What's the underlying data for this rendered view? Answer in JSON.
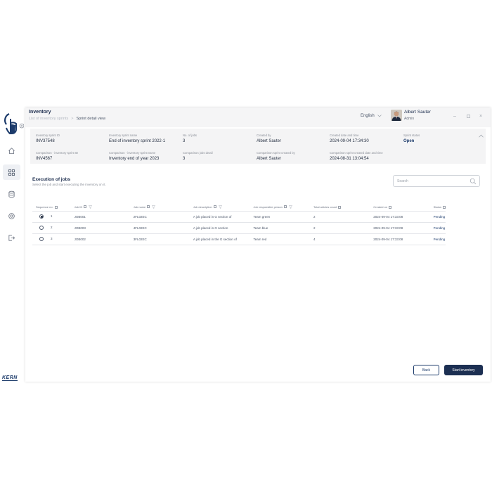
{
  "brand": "KERN",
  "header": {
    "title": "Inventory",
    "breadcrumb": [
      "List of inventory sprints",
      "Sprint detail view"
    ],
    "language": "English",
    "user_name": "Albert Sauter",
    "user_role": "Admin"
  },
  "info": {
    "fields": [
      {
        "label": "Inventory sprint ID",
        "value": "INV37548"
      },
      {
        "label": "Inventory sprint name",
        "value": "End of inventory sprint 2022-1"
      },
      {
        "label": "No. of jobs",
        "value": "3"
      },
      {
        "label": "Created by",
        "value": "Albert Sauter"
      },
      {
        "label": "Created date and time",
        "value": "2024-09-04 17:34:30"
      },
      {
        "label": "Sprint status",
        "value": "Open"
      },
      {
        "label": "Comparison - inventory sprint ID",
        "value": "INV4567"
      },
      {
        "label": "Comparison - inventory sprint name",
        "value": "Inventory end of year 2023"
      },
      {
        "label": "Comparison jobs detail",
        "value": "3"
      },
      {
        "label": "Comparison sprint created by",
        "value": "Albert Sauter"
      },
      {
        "label": "Comparison sprint created date and time",
        "value": "2024-08-31 13:04:54"
      }
    ]
  },
  "jobs": {
    "title": "Execution of jobs",
    "subtitle": "Select the job and start executing the inventory on it.",
    "search_placeholder": "Search",
    "columns": [
      "Sequence no.",
      "Job ID",
      "Job name",
      "Job description",
      "Job responsible person",
      "Total articles count",
      "Created on",
      "Status"
    ],
    "rows": [
      {
        "seq": "1",
        "id": "JOB001",
        "name": "2FL02EC",
        "desc": "A job placed in G section of",
        "person": "Team green",
        "count": "2",
        "created": "2024-09-04 17:33:08",
        "status": "Pending"
      },
      {
        "seq": "2",
        "id": "JOB003",
        "name": "4FL02EC",
        "desc": "A job placed in G section",
        "person": "Team blue",
        "count": "2",
        "created": "2024-09-04 17:33:08",
        "status": "Pending"
      },
      {
        "seq": "3",
        "id": "JOB002",
        "name": "3FL02EC",
        "desc": "A job placed in the G section of",
        "person": "Team red",
        "count": "4",
        "created": "2024-09-04 17:33:08",
        "status": "Pending"
      }
    ]
  },
  "buttons": {
    "back": "Back",
    "start": "Start inventory"
  },
  "colors": {
    "accent": "#1c2f52",
    "status": "#1c3b6b"
  },
  "icons": [
    "tap-hand-logo-icon",
    "home-icon",
    "grid-icon",
    "database-icon",
    "settings-icon",
    "logout-icon",
    "search-icon",
    "chevron-up-icon",
    "chevron-down-icon",
    "minimize-icon",
    "maximize-icon",
    "close-icon",
    "filter-icon",
    "sort-icon"
  ]
}
